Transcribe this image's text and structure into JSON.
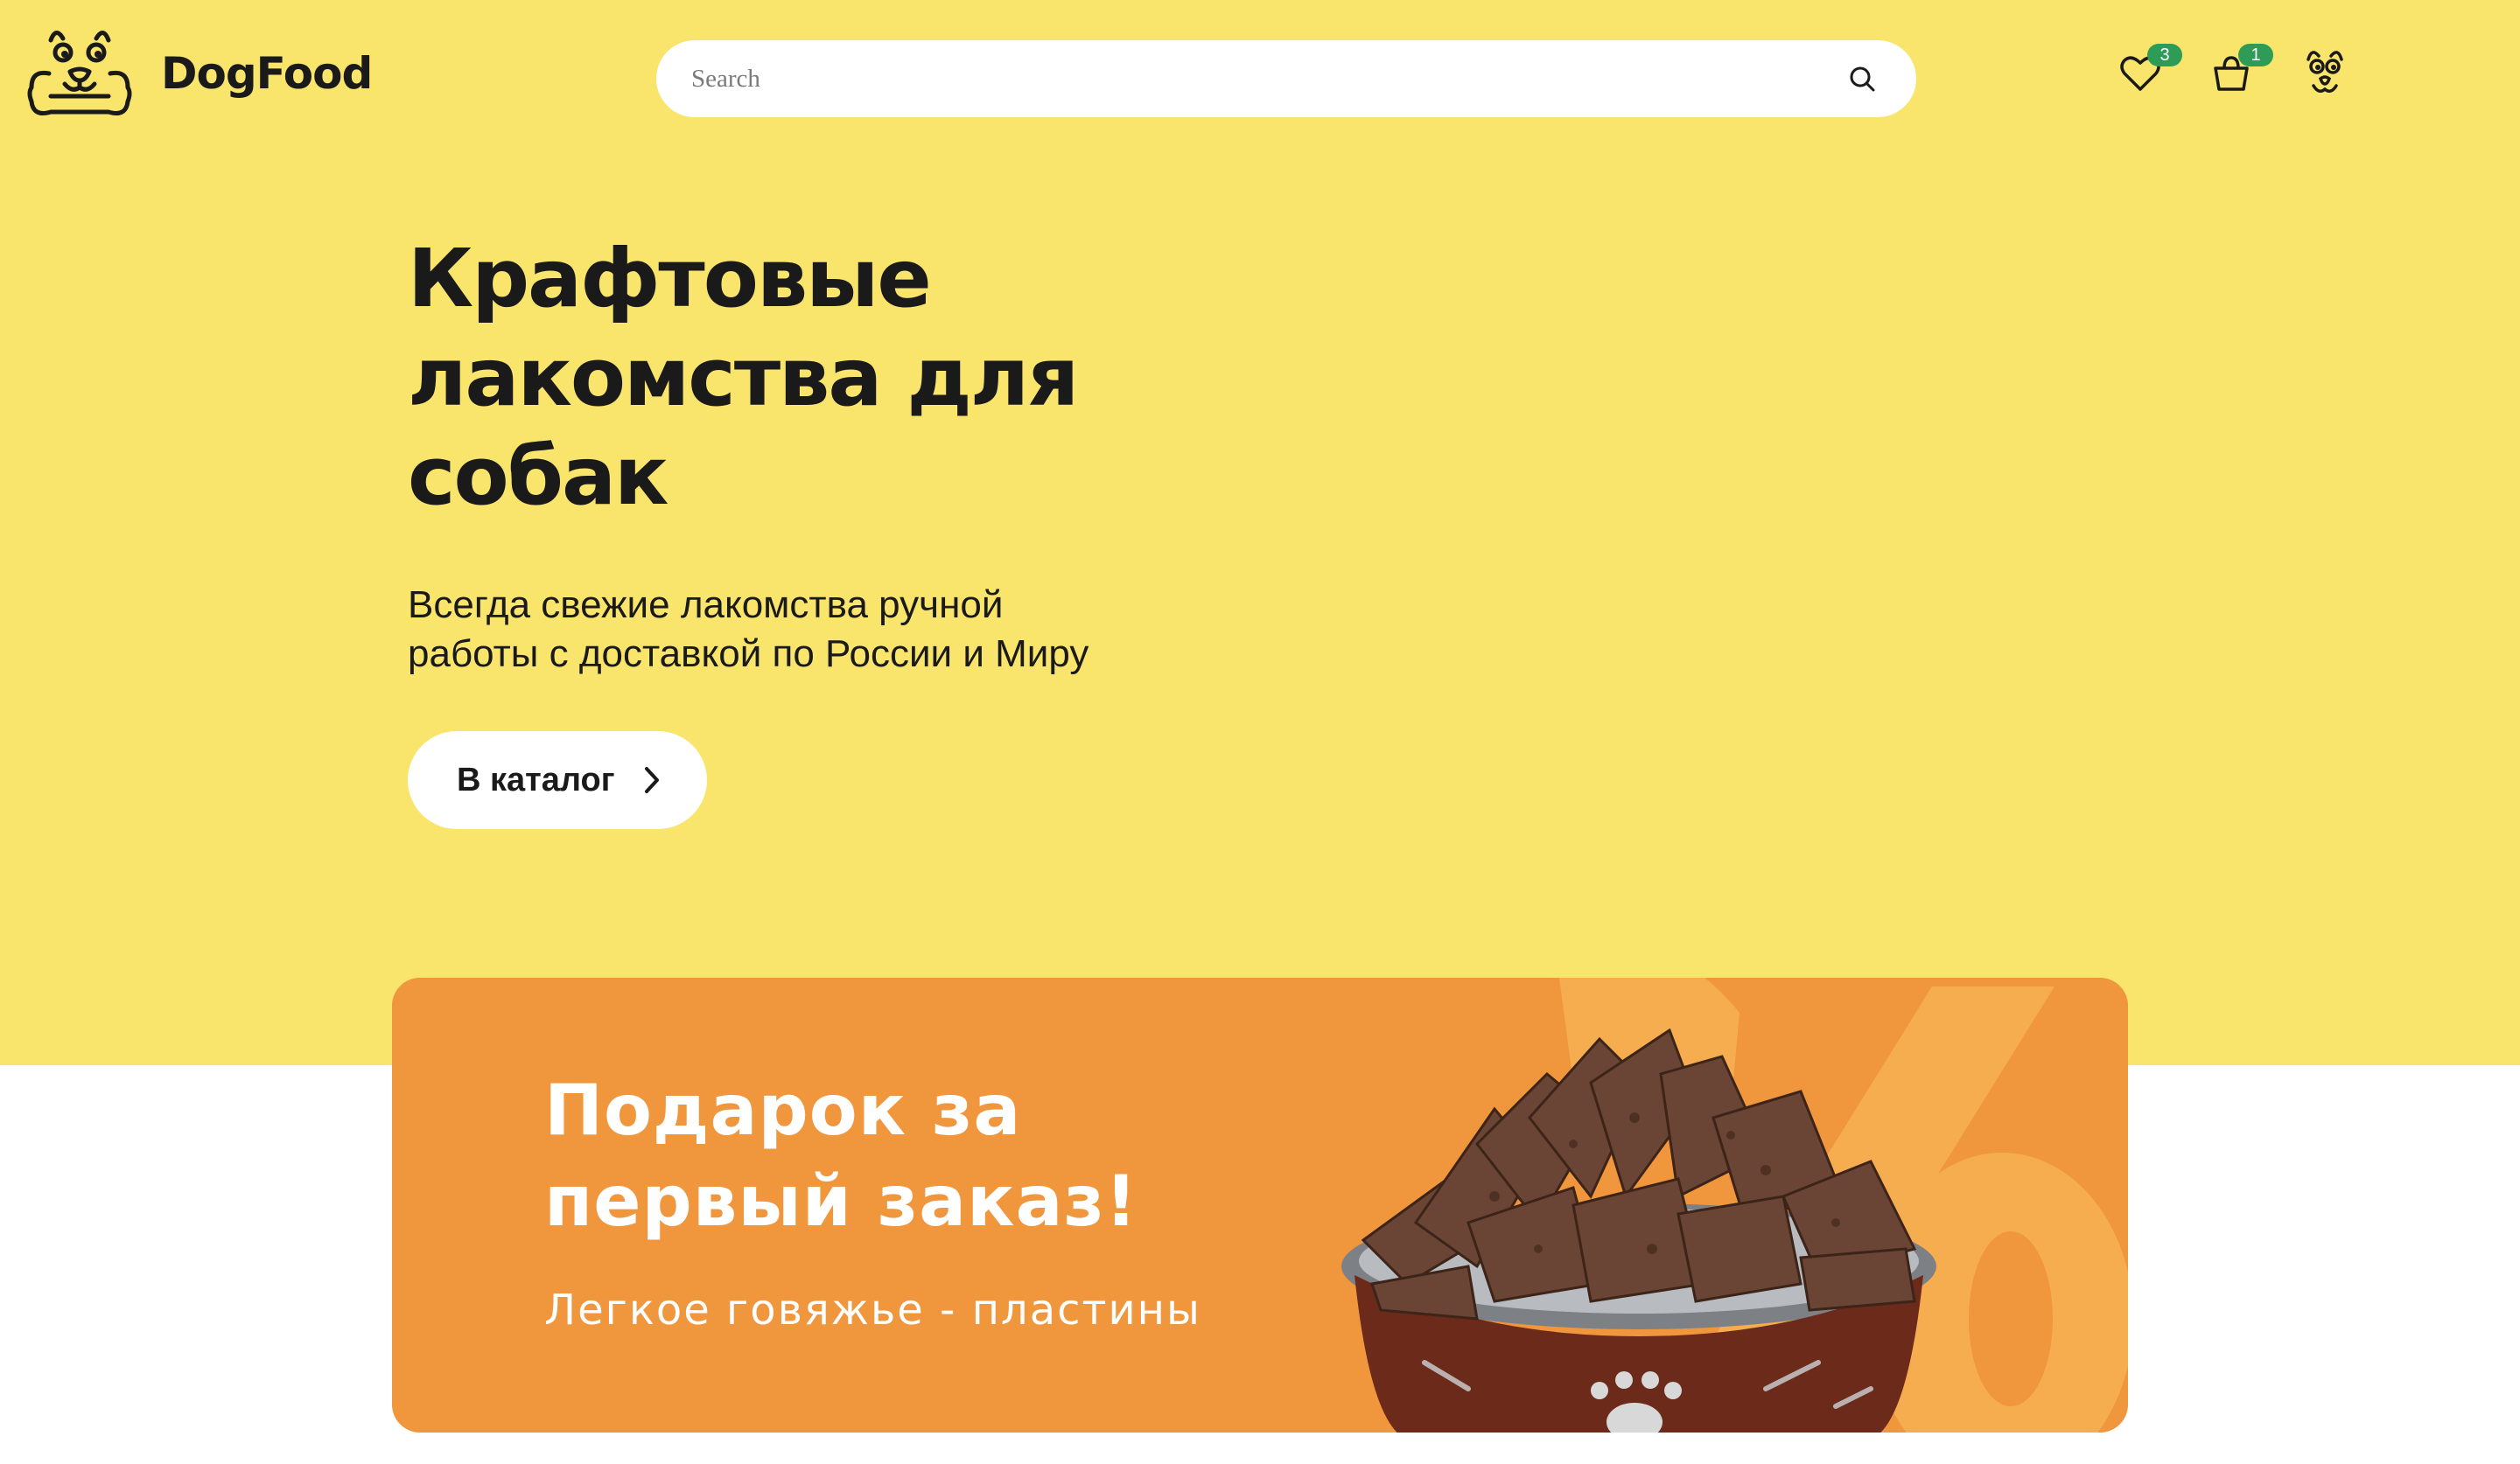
{
  "colors": {
    "hero_background": "#f9e46c",
    "promo_background": "#f0963d",
    "badge": "#2e9c56",
    "text_dark": "#1a1a1a",
    "white": "#ffffff"
  },
  "header": {
    "logo_text": "DogFood",
    "search_placeholder": "Search",
    "favorites_count": "3",
    "cart_count": "1",
    "icons": [
      "dog-logo-icon",
      "search-icon",
      "heart-icon",
      "bag-icon",
      "dog-profile-icon"
    ]
  },
  "hero": {
    "title_line1": "Крафтовые",
    "title_line2": "лакомства для",
    "title_line3": "собак",
    "subtitle_line1": "Всегда свежие лакомства ручной",
    "subtitle_line2": "работы с доставкой по России и Миру",
    "cta_label": "В каталог"
  },
  "promo": {
    "title_line1": "Подарок за",
    "title_line2": "первый заказ!",
    "subtitle": "Легкое говяжье - пластины"
  }
}
